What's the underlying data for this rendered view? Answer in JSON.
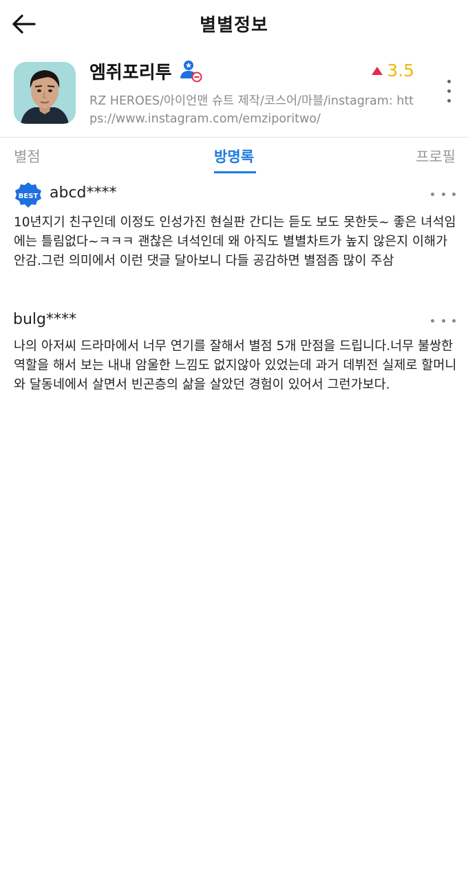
{
  "header": {
    "title": "별별정보",
    "back_icon": "arrow-left-icon"
  },
  "profile": {
    "name": "엠쥐포리투",
    "badge_icon": "user-blocked-icon",
    "rating": "3.5",
    "rating_trend_icon": "triangle-up-icon",
    "description": "RZ HEROES/아이언맨 슈트 제작/코스어/마블/instagram: https://www.instagram.com/emziporitwo/",
    "more_icon": "more-vertical-icon"
  },
  "tabs": [
    {
      "label": "별점",
      "active": false
    },
    {
      "label": "방명록",
      "active": true
    },
    {
      "label": "프로필",
      "active": false
    }
  ],
  "comments": [
    {
      "best": true,
      "best_label": "BEST",
      "user": "abcd****",
      "text": "10년지기 친구인데 이정도 인성가진 현실판 간디는 듣도 보도 못한듯~ 좋은 녀석임에는 틀림없다~ㅋㅋㅋ 괜찮은 녀석인데 왜 아직도 별별차트가 높지 않은지 이해가 안감.그런 의미에서 이런 댓글 달아보니 다들 공감하면 별점좀 많이 주삼"
    },
    {
      "best": false,
      "user": "bulg****",
      "text": "나의 아저씨 드라마에서 너무 연기를 잘해서 별점 5개 만점을 드립니다.너무 불쌍한 역할을 해서 보는 내내 암울한 느낌도 없지않아 있었는데 과거 데뷔전 실제로 할머니와 달동네에서 살면서 빈곤층의 삶을 살았던 경험이 있어서 그런가보다."
    }
  ],
  "colors": {
    "accent": "#1c7be0",
    "rating": "#f2b700",
    "trend_up": "#e8294a",
    "badge_blue": "#1e6fe0"
  }
}
